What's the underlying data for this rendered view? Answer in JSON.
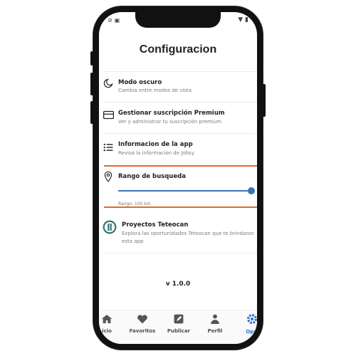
{
  "header": {
    "title": "Configuracion"
  },
  "settings": [
    {
      "icon": "moon-icon",
      "label": "Modo oscuro",
      "sub": "Cambia entre modos de vista"
    },
    {
      "icon": "card-icon",
      "label": "Gestionar suscripción Premium",
      "sub": "Ver y administrar tu suscripción premium"
    },
    {
      "icon": "list-icon",
      "label": "Informacion de la app",
      "sub": "Revisa la informacion de Jobsy"
    }
  ],
  "range": {
    "icon": "location-pin-icon",
    "label": "Rango de busqueda",
    "value_label": "Rango: 100 km",
    "slider_fraction": 1.0
  },
  "project": {
    "icon": "teteocan-logo-icon",
    "label": "Proyectos Teteocan",
    "sub_line1": "Explora las oportunidades Teteocan que te brindaron",
    "sub_line2": "esta app"
  },
  "version": "v 1.0.0",
  "nav": {
    "items": [
      {
        "label": "icio",
        "icon": "home-icon"
      },
      {
        "label": "Favoritos",
        "icon": "heart-icon"
      },
      {
        "label": "Publicar",
        "icon": "edit-icon"
      },
      {
        "label": "Perfil",
        "icon": "person-icon"
      },
      {
        "label": "Opci",
        "icon": "gear-icon",
        "active": true
      }
    ]
  },
  "colors": {
    "accent": "#3a73b8",
    "highlight_border": "#e36a2a",
    "active_nav": "#2f6fd6"
  }
}
